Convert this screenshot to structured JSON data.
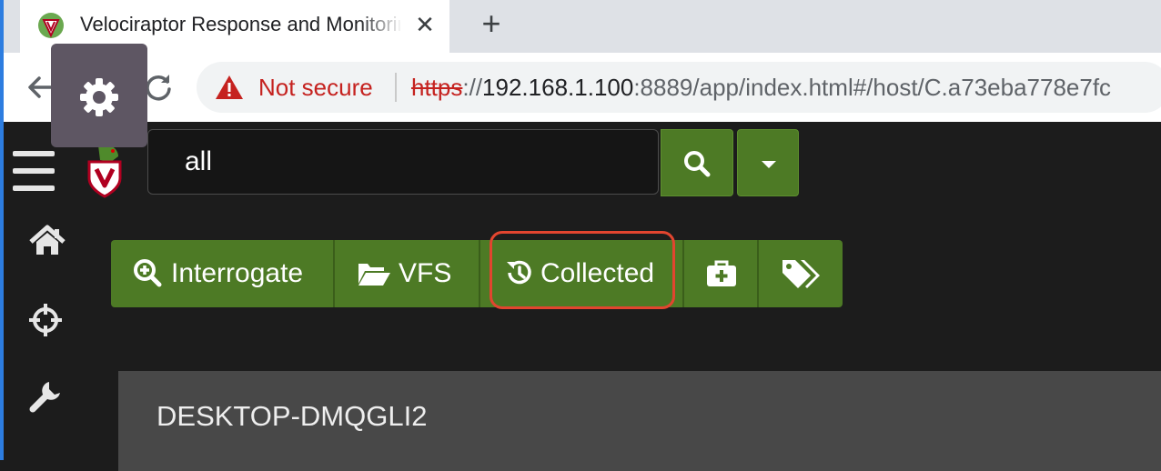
{
  "browser": {
    "tab_title": "Velociraptor Response and Monitoring",
    "tab_close": "✕",
    "new_tab": "+",
    "security_label": "Not secure",
    "url_scheme": "https",
    "url_sep": "://",
    "url_host": "192.168.1.100",
    "url_rest": ":8889/app/index.html#/host/C.a73eba778e7fc"
  },
  "app": {
    "search": {
      "value": "all"
    },
    "actions": {
      "interrogate": "Interrogate",
      "vfs": "VFS",
      "collected": "Collected"
    },
    "host": {
      "name": "DESKTOP-DMQGLI2"
    }
  },
  "colors": {
    "accent_green": "#4d7a25",
    "highlight": "#e2452f",
    "background": "#1c1c1c",
    "panel": "#484848"
  },
  "icons": [
    "settings-gear-icon",
    "warning-icon",
    "back-arrow-icon",
    "reload-icon",
    "velociraptor-logo",
    "hamburger-menu-icon",
    "search-icon",
    "caret-down-icon",
    "home-icon",
    "crosshairs-icon",
    "wrench-icon",
    "zoom-in-icon",
    "folder-open-icon",
    "history-icon",
    "medkit-icon",
    "tags-icon"
  ]
}
